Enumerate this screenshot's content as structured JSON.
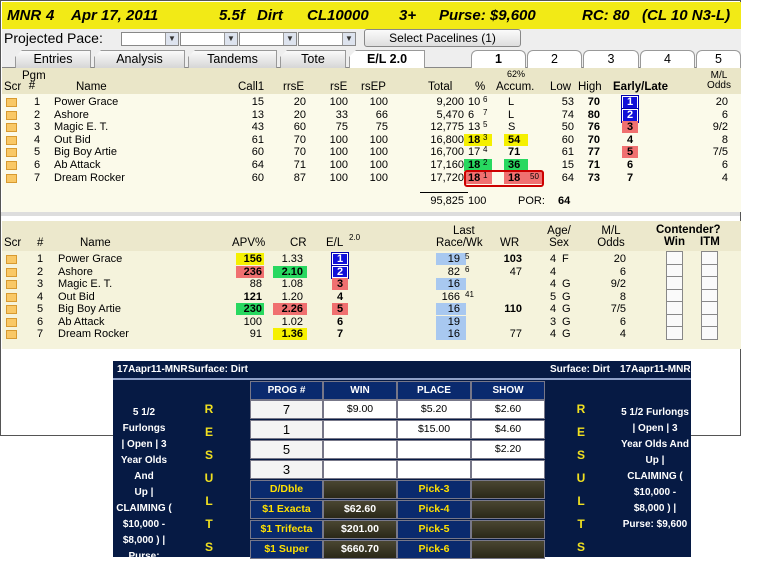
{
  "title": {
    "track": "MNR",
    "race": "4",
    "date": "Apr 17, 2011",
    "distance": "5.5f",
    "surface": "Dirt",
    "class": "CL10000",
    "age": "3+",
    "purse": "Purse: $9,600",
    "rc": "RC: 80",
    "rc_detail": "(CL 10 N3-L)"
  },
  "pace": {
    "label": "Projected Pace:",
    "button": "Select Pacelines  (1)"
  },
  "tabs": [
    "Entries",
    "Analysis",
    "Tandems",
    "Tote",
    "E/L 2.0"
  ],
  "num_tabs": [
    "1",
    "2",
    "3",
    "4",
    "5"
  ],
  "tote": {
    "headers": {
      "scr": "Scr",
      "pgm": "Pgm #",
      "name": "Name",
      "call1": "Call1",
      "rrse": "rrsE",
      "rse": "rsE",
      "rsep": "rsEP",
      "total": "Total",
      "pct": "%",
      "accum_top": "62%",
      "accum": "Accum.",
      "low": "Low",
      "high": "High",
      "el": "Early/Late",
      "ml": "M/L Odds"
    },
    "rows": [
      {
        "pgm": "1",
        "name": "Power Grace",
        "call1": "15",
        "rrse": "20",
        "rse": "100",
        "rsep": "100",
        "total": "9,200",
        "pct": "10",
        "pct_sup": "6",
        "accum": "L",
        "accum_sup": "",
        "low": "53",
        "high": "70",
        "el": "1",
        "ml": "20"
      },
      {
        "pgm": "2",
        "name": "Ashore",
        "call1": "13",
        "rrse": "20",
        "rse": "33",
        "rsep": "66",
        "total": "5,470",
        "pct": "6",
        "pct_sup": "7",
        "accum": "L",
        "accum_sup": "",
        "low": "74",
        "high": "80",
        "el": "2",
        "ml": "6"
      },
      {
        "pgm": "3",
        "name": "Magic E. T.",
        "call1": "43",
        "rrse": "60",
        "rse": "75",
        "rsep": "75",
        "total": "12,775",
        "pct": "13",
        "pct_sup": "5",
        "accum": "S",
        "accum_sup": "",
        "low": "50",
        "high": "76",
        "el": "3",
        "ml": "9/2"
      },
      {
        "pgm": "4",
        "name": "Out Bid",
        "call1": "61",
        "rrse": "70",
        "rse": "100",
        "rsep": "100",
        "total": "16,800",
        "pct": "18",
        "pct_sup": "3",
        "accum": "54",
        "accum_sup": "",
        "low": "60",
        "high": "70",
        "el": "4",
        "ml": "8"
      },
      {
        "pgm": "5",
        "name": "Big Boy Artie",
        "call1": "60",
        "rrse": "70",
        "rse": "100",
        "rsep": "100",
        "total": "16,700",
        "pct": "17",
        "pct_sup": "4",
        "accum": "71",
        "accum_sup": "",
        "low": "61",
        "high": "77",
        "el": "5",
        "ml": "7/5"
      },
      {
        "pgm": "6",
        "name": "Ab Attack",
        "call1": "64",
        "rrse": "71",
        "rse": "100",
        "rsep": "100",
        "total": "17,160",
        "pct": "18",
        "pct_sup": "2",
        "accum": "36",
        "accum_sup": "",
        "low": "15",
        "high": "71",
        "el": "6",
        "ml": "6"
      },
      {
        "pgm": "7",
        "name": "Dream Rocker",
        "call1": "60",
        "rrse": "87",
        "rse": "100",
        "rsep": "100",
        "total": "17,720",
        "pct": "18",
        "pct_sup": "1",
        "accum": "18",
        "accum_sup": "50",
        "low": "64",
        "high": "73",
        "el": "7",
        "ml": "4"
      }
    ],
    "totals": {
      "total": "95,825",
      "pct": "100",
      "por_label": "POR:",
      "por": "64"
    }
  },
  "el": {
    "headers": {
      "scr": "Scr",
      "pgm": "#",
      "name": "Name",
      "apv": "APV%",
      "cr": "CR",
      "el": "E/L",
      "el_sup": "2.0",
      "last": "Last",
      "racewk": "Race/Wk",
      "wr": "WR",
      "agesex": "Age/ Sex",
      "ml": "M/L Odds",
      "contender": "Contender?",
      "win": "Win",
      "itm": "ITM"
    },
    "rows": [
      {
        "pgm": "1",
        "name": "Power Grace",
        "apv": "156",
        "cr": "1.33",
        "el": "1",
        "last": "19",
        "last_sup": "5",
        "wr": "103",
        "age": "4",
        "sex": "F",
        "ml": "20"
      },
      {
        "pgm": "2",
        "name": "Ashore",
        "apv": "236",
        "cr": "2.10",
        "el": "2",
        "last": "82",
        "last_sup": "6",
        "wr": "47",
        "age": "4",
        "sex": "",
        "ml": "6"
      },
      {
        "pgm": "3",
        "name": "Magic E. T.",
        "apv": "88",
        "cr": "1.08",
        "el": "3",
        "last": "16",
        "last_sup": "",
        "wr": "",
        "age": "4",
        "sex": "G",
        "ml": "9/2"
      },
      {
        "pgm": "4",
        "name": "Out Bid",
        "apv": "121",
        "cr": "1.20",
        "el": "4",
        "last": "166",
        "last_sup": "41",
        "wr": "",
        "age": "5",
        "sex": "G",
        "ml": "8"
      },
      {
        "pgm": "5",
        "name": "Big Boy Artie",
        "apv": "230",
        "cr": "2.26",
        "el": "5",
        "last": "16",
        "last_sup": "",
        "wr": "110",
        "age": "4",
        "sex": "G",
        "ml": "7/5"
      },
      {
        "pgm": "6",
        "name": "Ab Attack",
        "apv": "100",
        "cr": "1.02",
        "el": "6",
        "last": "19",
        "last_sup": "",
        "wr": "",
        "age": "3",
        "sex": "G",
        "ml": "6"
      },
      {
        "pgm": "7",
        "name": "Dream Rocker",
        "apv": "91",
        "cr": "1.36",
        "el": "7",
        "last": "16",
        "last_sup": "",
        "wr": "77",
        "age": "4",
        "sex": "G",
        "ml": "4"
      }
    ]
  },
  "results": {
    "left_title": "17Aapr11-MNR",
    "left_surface": "Surface: Dirt",
    "right_surface": "Surface: Dirt",
    "right_title": "17Aapr11-MNR",
    "side_text": [
      "5 1/2 Furlongs",
      "| Open | 3",
      "Year Olds And",
      "Up |",
      "CLAIMING (",
      "$10,000 -",
      "$8,000 ) |",
      "Purse: $9,600"
    ],
    "side_letters": [
      "R",
      "E",
      "S",
      "U",
      "L",
      "T",
      "S"
    ],
    "headers": [
      "PROG #",
      "WIN",
      "PLACE",
      "SHOW"
    ],
    "rows": [
      {
        "prog": "7",
        "win": "$9.00",
        "place": "$5.20",
        "show": "$2.60"
      },
      {
        "prog": "1",
        "win": "",
        "place": "$15.00",
        "show": "$4.60"
      },
      {
        "prog": "5",
        "win": "",
        "place": "",
        "show": "$2.20"
      },
      {
        "prog": "3",
        "win": "",
        "place": "",
        "show": ""
      }
    ],
    "exotics": [
      {
        "label": "D/Dble",
        "value": "",
        "pick": "Pick-3",
        "pick_value": ""
      },
      {
        "label": "$1 Exacta",
        "value": "$62.60",
        "pick": "Pick-4",
        "pick_value": ""
      },
      {
        "label": "$1 Trifecta",
        "value": "$201.00",
        "pick": "Pick-5",
        "pick_value": ""
      },
      {
        "label": "$1 Super",
        "value": "$660.70",
        "pick": "Pick-6",
        "pick_value": ""
      }
    ]
  },
  "colors": {
    "title_bg": "#f2ea16",
    "yellow": "#f5f000",
    "green": "#28d860",
    "red": "#f07070",
    "blue": "#1010d8",
    "lightblue": "#a8c8f0",
    "navy": "#061a44"
  }
}
